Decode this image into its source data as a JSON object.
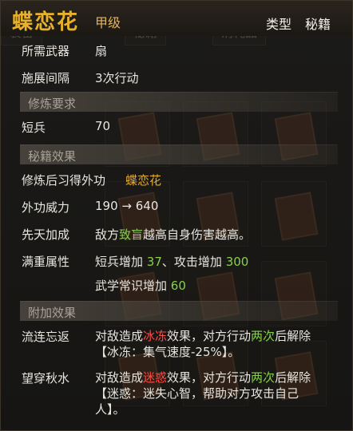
{
  "title": "蝶恋花",
  "grade": "甲级",
  "type": {
    "label": "类型",
    "value": "秘籍"
  },
  "required_weapon": {
    "label": "所需武器",
    "value": "扇"
  },
  "cast_interval": {
    "label": "施展间隔",
    "value": "3次行动"
  },
  "sections": {
    "cultivation_requirement": "修炼要求",
    "skill_effect": "秘籍效果",
    "additional_effect": "附加效果"
  },
  "requirement": {
    "label": "短兵",
    "value": "70"
  },
  "effects": {
    "learn": {
      "label": "修炼后习得外功",
      "value": "蝶恋花"
    },
    "power": {
      "label": "外功威力",
      "value": "190 → 640"
    },
    "innate": {
      "label": "先天加成",
      "text_before": "敌方",
      "highlight": "致盲",
      "text_after": "越高自身伤害越高。"
    },
    "max": {
      "label": "满重属性",
      "line1_part1": "短兵增加",
      "line1_value1": "37",
      "line1_part2": "、攻击增加",
      "line1_value2": "300",
      "line2_part1": "武学常识增加",
      "line2_value1": "60"
    }
  },
  "extra_effects": [
    {
      "name": "流连忘返",
      "line1_before": "对敌造成",
      "line1_red": "冰冻",
      "line1_mid": "效果，对方行动",
      "line1_green": "两次",
      "line1_after": "后解除",
      "line2": "【冰冻：集气速度-25%】。"
    },
    {
      "name": "望穿秋水",
      "line1_before": "对敌造成",
      "line1_red": "迷惑",
      "line1_mid": "效果，对方行动",
      "line1_green": "两次",
      "line1_after": "后解除",
      "line2": "【迷惑：迷失心智，帮助对方攻击自己",
      "line3": "人】。"
    }
  ]
}
